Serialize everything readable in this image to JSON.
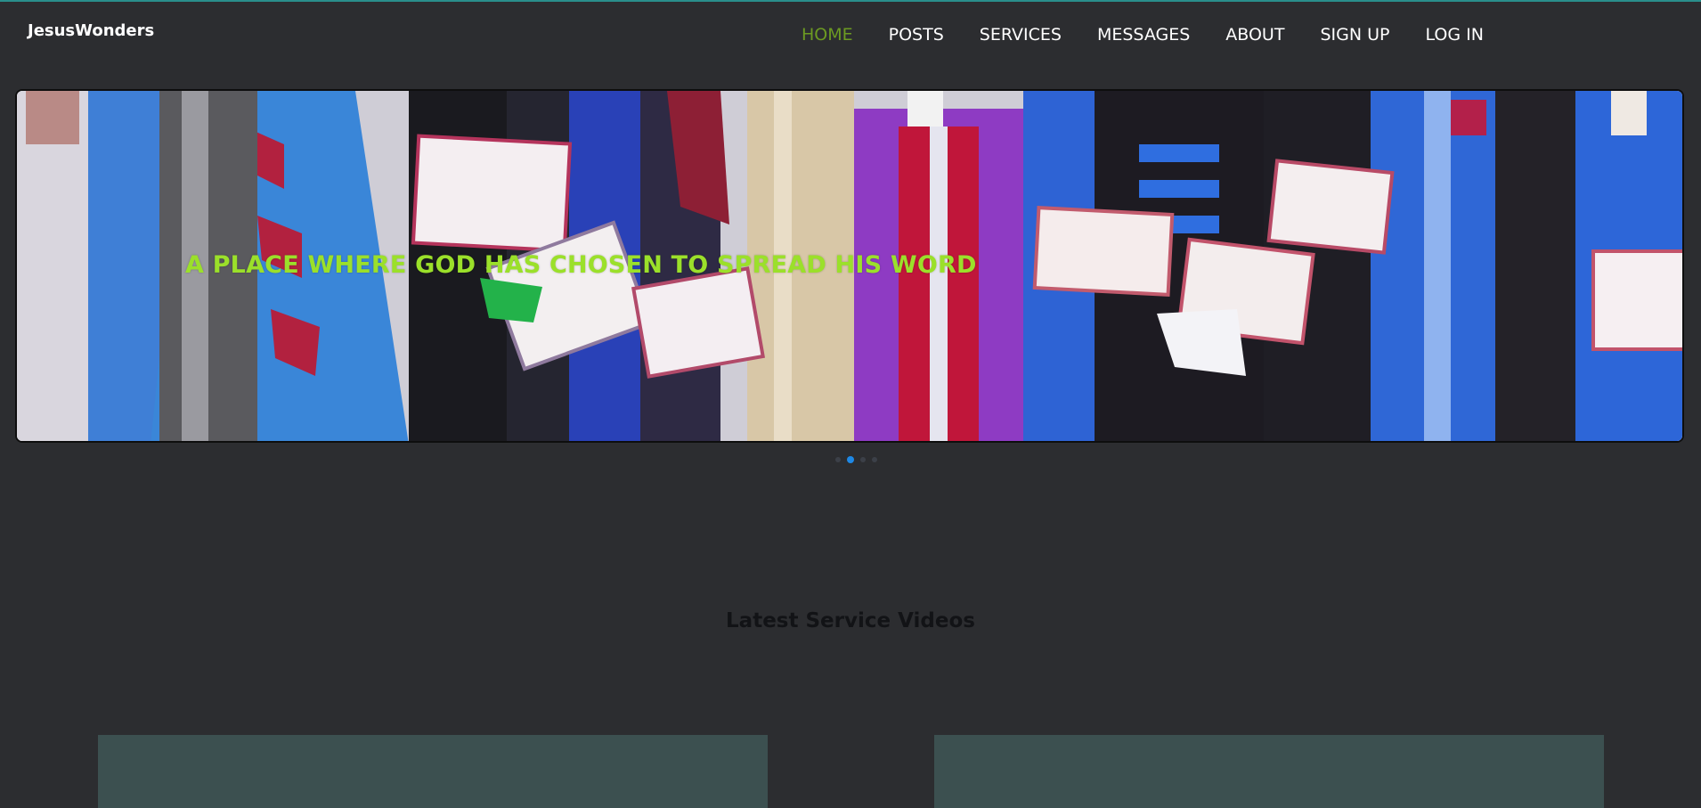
{
  "brand": {
    "name": "JesusWonders"
  },
  "nav": {
    "items": [
      {
        "label": "HOME",
        "active": true
      },
      {
        "label": "POSTS"
      },
      {
        "label": "SERVICES"
      },
      {
        "label": "MESSAGES"
      },
      {
        "label": "ABOUT"
      },
      {
        "label": "SIGN UP"
      },
      {
        "label": "LOG IN"
      }
    ]
  },
  "carousel": {
    "caption": "A PLACE WHERE GOD HAS CHOSEN TO SPREAD HIS WORD",
    "slide_count": 4,
    "active_slide": 2
  },
  "sections": {
    "latest_videos_title": "Latest Service Videos"
  },
  "colors": {
    "background": "#2c2d30",
    "nav_active": "#6c9a22",
    "caption": "#9be02a",
    "indicator_active": "#1e88e5",
    "video_card": "#3c5050"
  }
}
